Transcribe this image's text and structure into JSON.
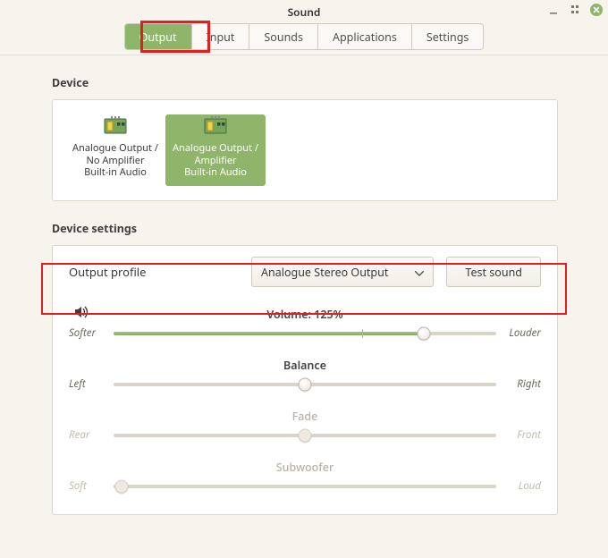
{
  "title": "Sound",
  "tabs": [
    "Output",
    "Input",
    "Sounds",
    "Applications",
    "Settings"
  ],
  "activeTab": "Output",
  "section_device": "Device",
  "devices": [
    {
      "line1": "Analogue Output /",
      "line2": "No Amplifier",
      "line3": "Built-in Audio"
    },
    {
      "line1": "Analogue Output /",
      "line2": "Amplifier",
      "line3": "Built-in Audio"
    }
  ],
  "section_settings": "Device settings",
  "profile_label": "Output profile",
  "profile_value": "Analogue Stereo Output",
  "test_button": "Test sound",
  "sliders": {
    "volume": {
      "title": "Volume: 125%",
      "left": "Softer",
      "right": "Louder",
      "valuePct": 81,
      "tickPct": 65
    },
    "balance": {
      "title": "Balance",
      "left": "Left",
      "right": "Right",
      "valuePct": 50
    },
    "fade": {
      "title": "Fade",
      "left": "Rear",
      "right": "Front",
      "valuePct": 50
    },
    "sub": {
      "title": "Subwoofer",
      "left": "Soft",
      "right": "Loud",
      "valuePct": 2
    }
  }
}
